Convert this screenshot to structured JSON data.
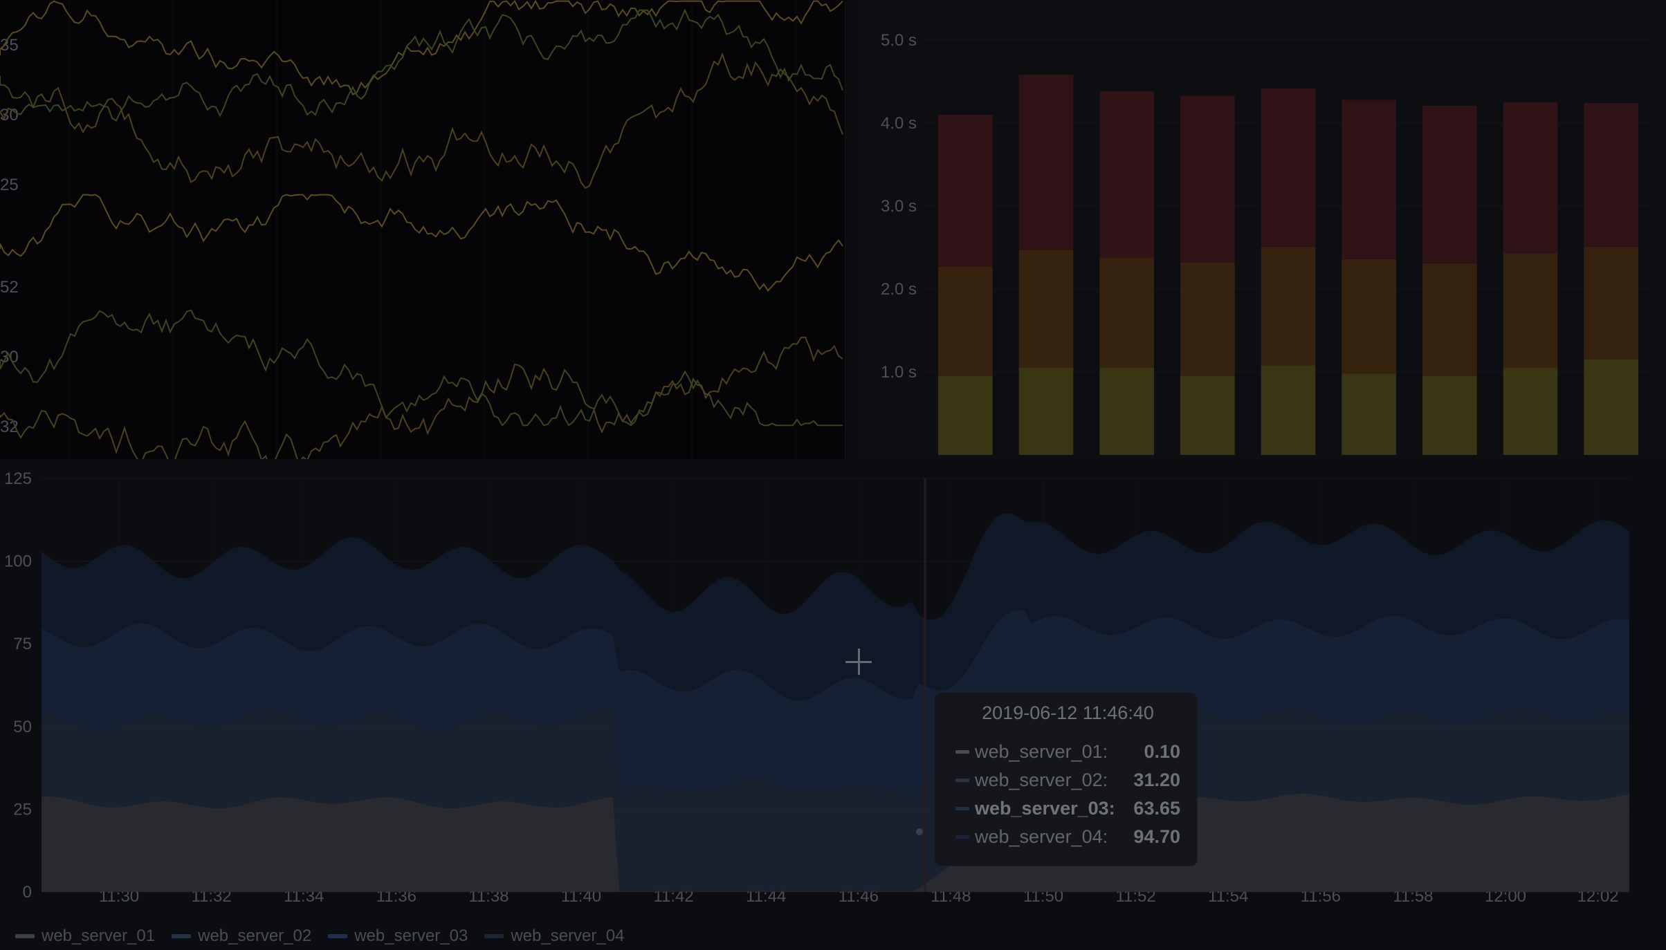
{
  "top_left_panel": {
    "y_ticks": [
      "35",
      "30",
      "25",
      "52",
      "30",
      "32"
    ],
    "line_colors": [
      "#5a4b23",
      "#3a4621",
      "#4d4020"
    ]
  },
  "top_right_panel": {
    "chart_data": {
      "type": "bar",
      "title": "",
      "xlabel": "",
      "ylabel": "",
      "ylim": [
        0,
        5
      ],
      "y_ticks": [
        "1.0 s",
        "2.0 s",
        "3.0 s",
        "4.0 s",
        "5.0 s"
      ],
      "series": [
        {
          "values": [
            0.95,
            1.05,
            1.05,
            0.95,
            1.08,
            0.98,
            0.95,
            1.05,
            1.15
          ],
          "color": "#3a3512"
        },
        {
          "values": [
            1.32,
            1.42,
            1.33,
            1.37,
            1.43,
            1.38,
            1.36,
            1.38,
            1.36
          ],
          "color": "#35220f"
        },
        {
          "values": [
            1.83,
            2.11,
            2.0,
            2.01,
            1.91,
            1.92,
            1.9,
            1.82,
            1.73
          ],
          "color": "#2f1316"
        }
      ]
    }
  },
  "bottom_panel": {
    "chart_data": {
      "type": "area",
      "title": "",
      "xlabel": "",
      "ylabel": "",
      "ylim": [
        0,
        125
      ],
      "y_ticks": [
        "0",
        "25",
        "50",
        "75",
        "100",
        "125"
      ],
      "x_ticks": [
        "11:30",
        "11:32",
        "11:34",
        "11:36",
        "11:38",
        "11:40",
        "11:42",
        "11:44",
        "11:46",
        "11:48",
        "11:50",
        "11:52",
        "11:54",
        "11:56",
        "11:58",
        "12:00",
        "12:02"
      ],
      "stacked": true,
      "series": [
        {
          "name": "web_server_01",
          "color": "#2a2c33"
        },
        {
          "name": "web_server_02",
          "color": "#1b2433"
        },
        {
          "name": "web_server_03",
          "color": "#17223a"
        },
        {
          "name": "web_server_04",
          "color": "#111a2a"
        }
      ]
    },
    "tooltip": {
      "time": "2019-06-12 11:46:40",
      "rows": [
        {
          "label": "web_server_01:",
          "value": "0.10",
          "color": "#4a4d54"
        },
        {
          "label": "web_server_02:",
          "value": "31.20",
          "color": "#293445"
        },
        {
          "label": "web_server_03:",
          "value": "63.65",
          "color": "#1f2d45"
        },
        {
          "label": "web_server_04:",
          "value": "94.70",
          "color": "#1a2539"
        }
      ]
    }
  },
  "legend": [
    {
      "label": "web_server_01",
      "color": "#3d4047"
    },
    {
      "label": "web_server_02",
      "color": "#243247"
    },
    {
      "label": "web_server_03",
      "color": "#1f2e49"
    },
    {
      "label": "web_server_04",
      "color": "#1b2538"
    }
  ]
}
